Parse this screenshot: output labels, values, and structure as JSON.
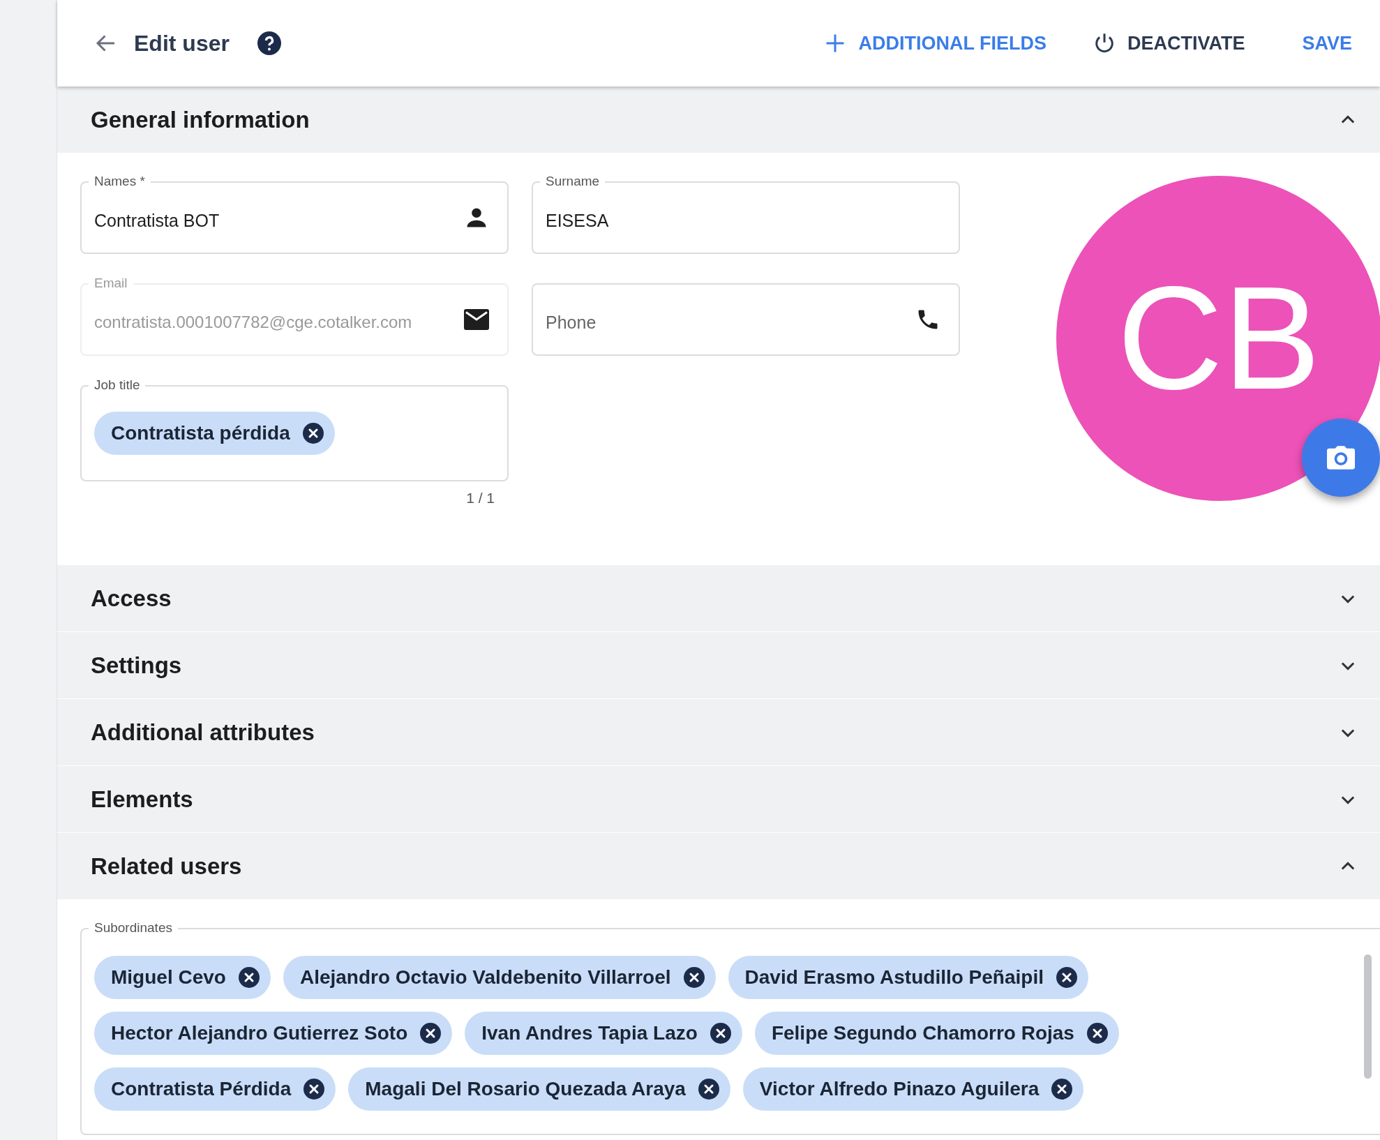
{
  "header": {
    "title": "Edit user",
    "actions": [
      {
        "label": "ADDITIONAL FIELDS",
        "kind": "add"
      },
      {
        "label": "DEACTIVATE",
        "kind": "power"
      },
      {
        "label": "SAVE",
        "kind": "save"
      }
    ]
  },
  "sections": [
    {
      "title": "General information",
      "kind": "general",
      "expanded": true
    },
    {
      "title": "Access",
      "expanded": false
    },
    {
      "title": "Settings",
      "expanded": false
    },
    {
      "title": "Additional attributes",
      "expanded": false
    },
    {
      "title": "Elements",
      "expanded": false
    },
    {
      "title": "Related users",
      "kind": "related",
      "expanded": true
    }
  ],
  "general": {
    "fields": [
      {
        "label": "Names *",
        "value": "Contratista BOT",
        "kind": "name",
        "disabled": false
      },
      {
        "label": "Surname",
        "value": "EISESA",
        "kind": "text",
        "disabled": false
      },
      {
        "label": "Email",
        "value": "contratista.0001007782@cge.cotalker.com",
        "kind": "email",
        "disabled": true
      },
      {
        "placeholder": "Phone",
        "kind": "phone",
        "disabled": false
      }
    ],
    "job_title": {
      "label": "Job title",
      "chips": [
        "Contratista pérdida"
      ],
      "counter": "1 / 1"
    },
    "avatar": {
      "initials": "CB",
      "color": "#ec52b8"
    }
  },
  "related": {
    "label": "Subordinates",
    "chips": [
      "Miguel Cevo",
      "Alejandro Octavio Valdebenito Villarroel",
      "David Erasmo Astudillo Peñaipil",
      "Hector Alejandro Gutierrez Soto",
      "Ivan Andres Tapia Lazo",
      "Felipe Segundo Chamorro Rojas",
      "Contratista Pérdida",
      "Magali Del Rosario Quezada Araya",
      "Victor Alfredo Pinazo Aguilera"
    ]
  }
}
